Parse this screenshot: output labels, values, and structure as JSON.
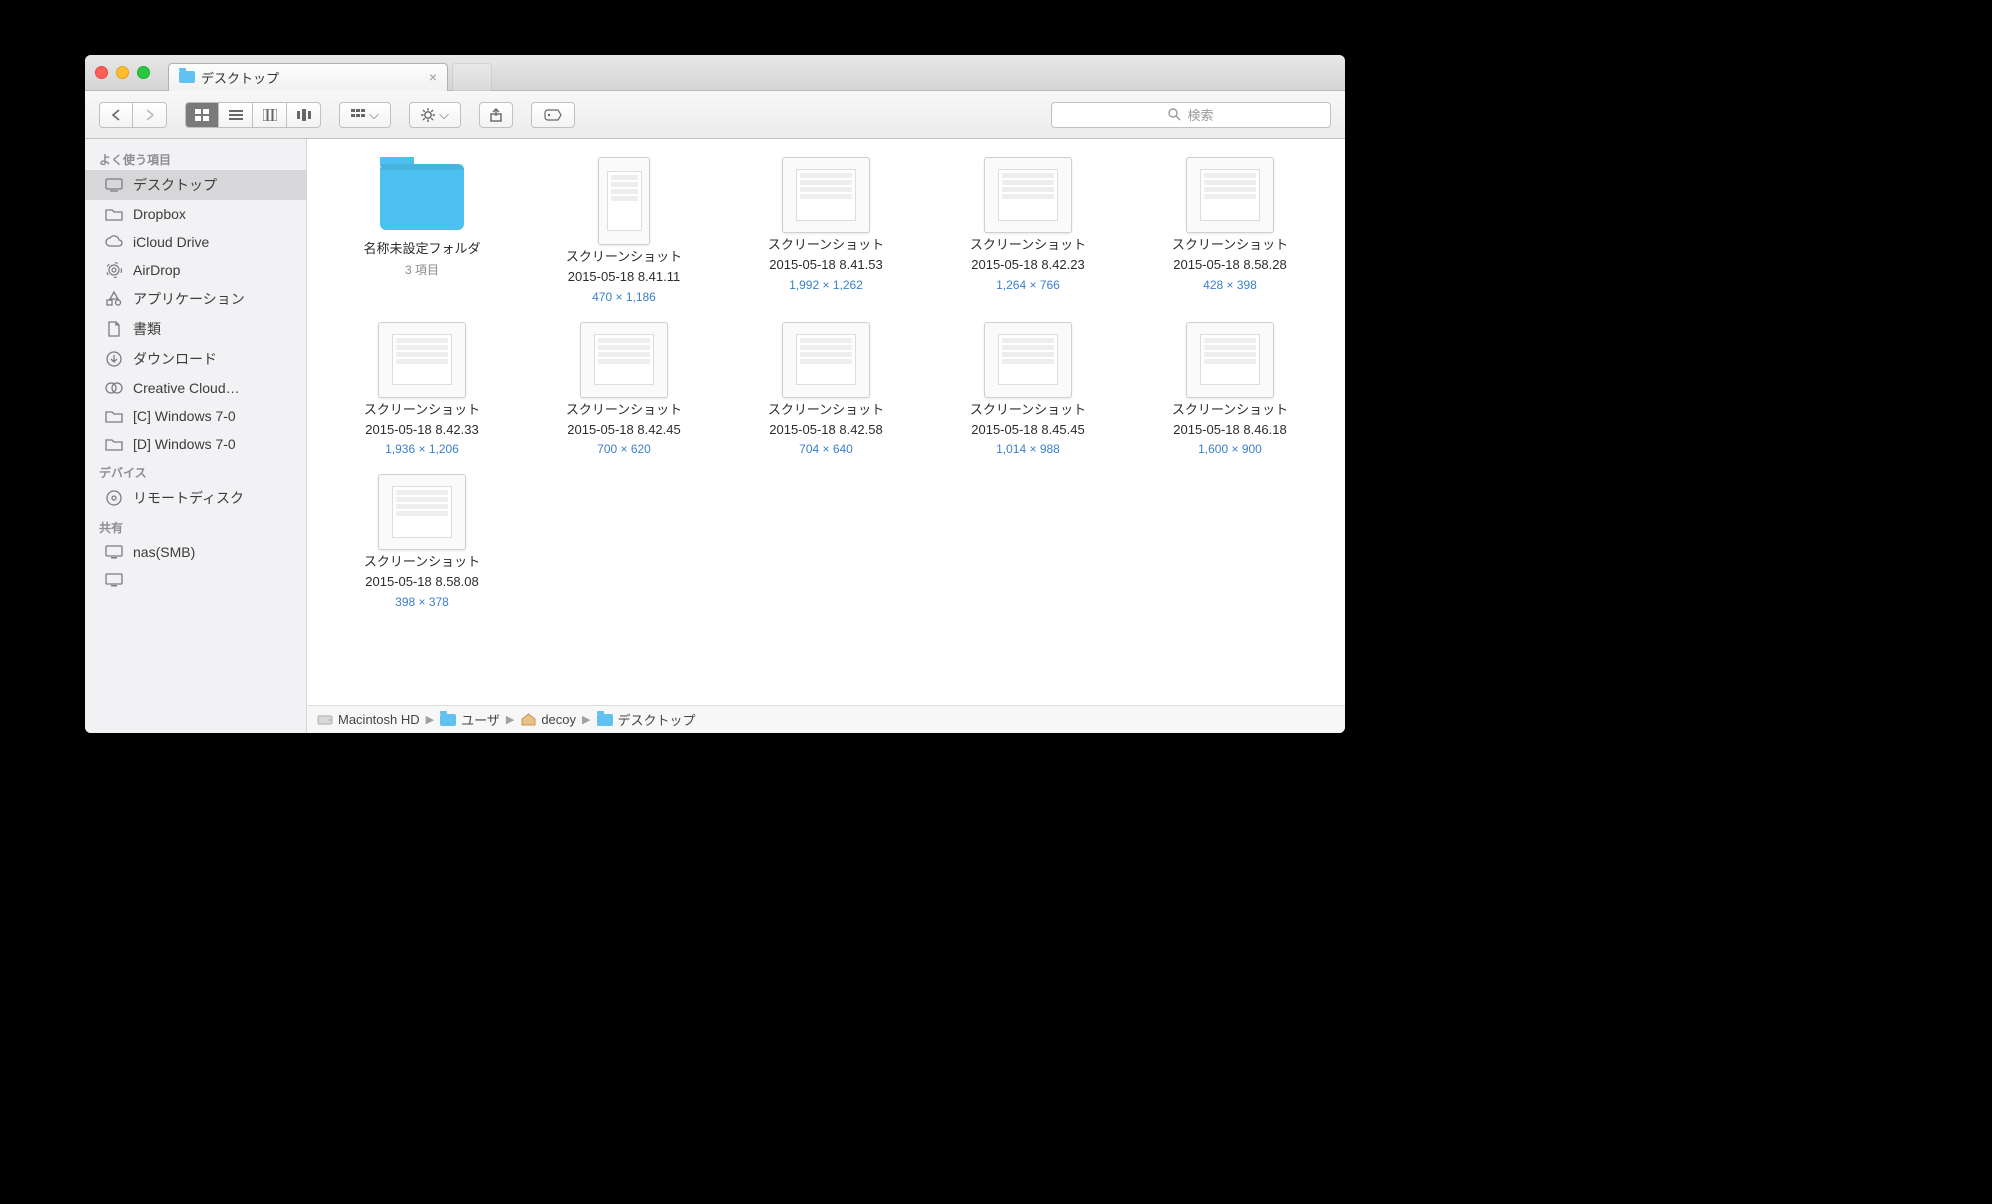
{
  "tab": {
    "title": "デスクトップ"
  },
  "search": {
    "placeholder": "検索"
  },
  "sidebar": {
    "sections": [
      {
        "title": "よく使う項目",
        "items": [
          {
            "label": "デスクトップ",
            "icon": "desktop",
            "selected": true
          },
          {
            "label": "Dropbox",
            "icon": "folder"
          },
          {
            "label": "iCloud Drive",
            "icon": "cloud"
          },
          {
            "label": "AirDrop",
            "icon": "airdrop"
          },
          {
            "label": "アプリケーション",
            "icon": "apps"
          },
          {
            "label": "書類",
            "icon": "doc"
          },
          {
            "label": "ダウンロード",
            "icon": "download"
          },
          {
            "label": "Creative Cloud…",
            "icon": "cc"
          },
          {
            "label": "[C] Windows 7-0",
            "icon": "folder"
          },
          {
            "label": "[D] Windows 7-0",
            "icon": "folder"
          }
        ]
      },
      {
        "title": "デバイス",
        "items": [
          {
            "label": "リモートディスク",
            "icon": "disc"
          }
        ]
      },
      {
        "title": "共有",
        "items": [
          {
            "label": "nas(SMB)",
            "icon": "screen"
          },
          {
            "label": "",
            "icon": "screen"
          }
        ]
      }
    ]
  },
  "items": [
    {
      "kind": "folder",
      "name": "名称未設定フォルダ",
      "sub": "3 項目"
    },
    {
      "kind": "image",
      "name1": "スクリーンショット",
      "name2": "2015-05-18 8.41.11",
      "dim": "470 × 1,186",
      "tall": true
    },
    {
      "kind": "image",
      "name1": "スクリーンショット",
      "name2": "2015-05-18 8.41.53",
      "dim": "1,992 × 1,262"
    },
    {
      "kind": "image",
      "name1": "スクリーンショット",
      "name2": "2015-05-18 8.42.23",
      "dim": "1,264 × 766"
    },
    {
      "kind": "image",
      "name1": "スクリーンショット",
      "name2": "2015-05-18 8.58.28",
      "dim": "428 × 398"
    },
    {
      "kind": "image",
      "name1": "スクリーンショット",
      "name2": "2015-05-18 8.42.33",
      "dim": "1,936 × 1,206"
    },
    {
      "kind": "image",
      "name1": "スクリーンショット",
      "name2": "2015-05-18 8.42.45",
      "dim": "700 × 620"
    },
    {
      "kind": "image",
      "name1": "スクリーンショット",
      "name2": "2015-05-18 8.42.58",
      "dim": "704 × 640"
    },
    {
      "kind": "image",
      "name1": "スクリーンショット",
      "name2": "2015-05-18 8.45.45",
      "dim": "1,014 × 988"
    },
    {
      "kind": "image",
      "name1": "スクリーンショット",
      "name2": "2015-05-18 8.46.18",
      "dim": "1,600 × 900"
    },
    {
      "kind": "image",
      "name1": "スクリーンショット",
      "name2": "2015-05-18 8.58.08",
      "dim": "398 × 378"
    }
  ],
  "path": [
    {
      "label": "Macintosh HD",
      "icon": "hd"
    },
    {
      "label": "ユーザ",
      "icon": "bluefolder"
    },
    {
      "label": "decoy",
      "icon": "home"
    },
    {
      "label": "デスクトップ",
      "icon": "bluefolder"
    }
  ]
}
